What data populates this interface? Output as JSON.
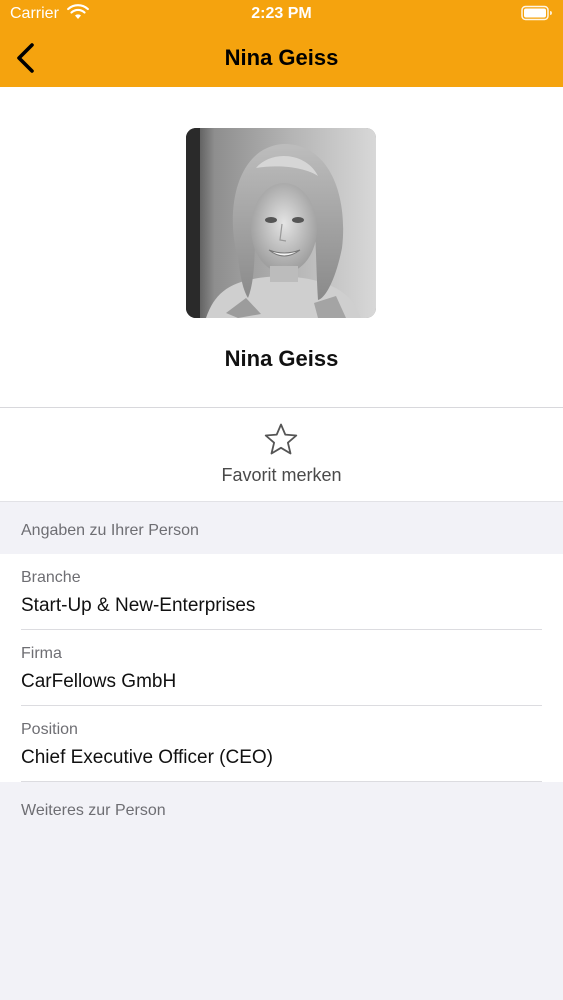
{
  "status_bar": {
    "carrier": "Carrier",
    "time": "2:23 PM"
  },
  "nav": {
    "title": "Nina Geiss",
    "back_icon": "chevron-left-icon"
  },
  "profile": {
    "name": "Nina Geiss",
    "photo_icon": "profile-photo"
  },
  "favorite": {
    "label": "Favorit merken",
    "icon": "star-outline-icon"
  },
  "sections": {
    "person_header": "Angaben zu Ihrer Person",
    "more_header": "Weiteres zur Person"
  },
  "details": [
    {
      "label": "Branche",
      "value": "Start-Up & New-Enterprises"
    },
    {
      "label": "Firma",
      "value": "CarFellows GmbH"
    },
    {
      "label": "Position",
      "value": "Chief Executive Officer (CEO)"
    }
  ],
  "colors": {
    "accent": "#f5a30e",
    "background": "#f2f2f7",
    "secondary_text": "#6e6e73"
  }
}
